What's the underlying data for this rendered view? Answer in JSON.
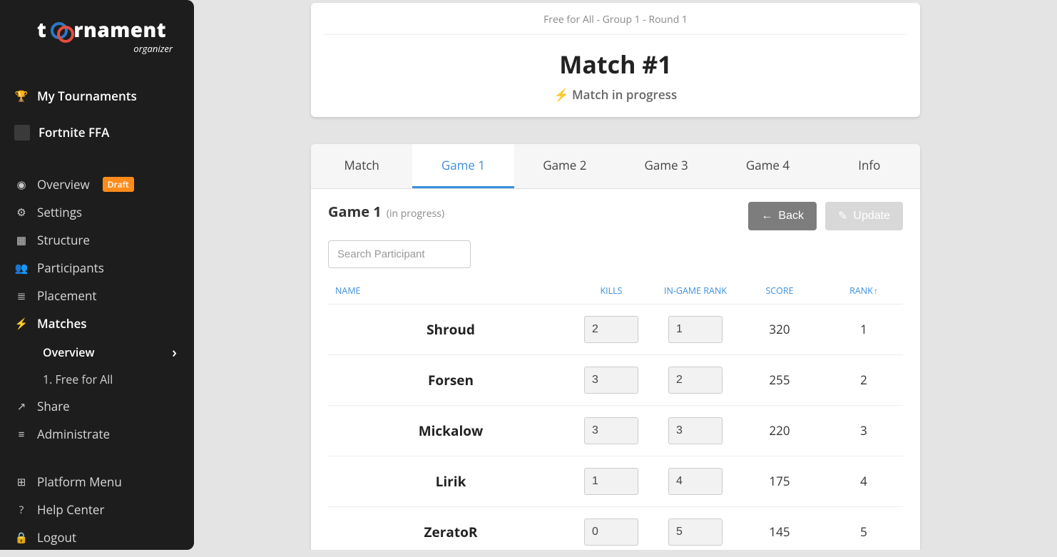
{
  "brand": {
    "name": "toornament",
    "subtitle": "organizer"
  },
  "sidebar": {
    "my_tournaments": "My Tournaments",
    "current_tournament": "Fortnite FFA",
    "items": [
      {
        "label": "Overview",
        "badge": "Draft"
      },
      {
        "label": "Settings"
      },
      {
        "label": "Structure"
      },
      {
        "label": "Participants"
      },
      {
        "label": "Placement"
      },
      {
        "label": "Matches"
      }
    ],
    "matches_sub": {
      "overview": "Overview",
      "stage": "1. Free for All"
    },
    "extra": [
      {
        "label": "Share"
      },
      {
        "label": "Administrate"
      }
    ],
    "bottom": [
      {
        "label": "Platform Menu"
      },
      {
        "label": "Help Center"
      },
      {
        "label": "Logout"
      }
    ]
  },
  "header": {
    "breadcrumb": "Free for All - Group 1 - Round 1",
    "title": "Match #1",
    "status": "Match in progress"
  },
  "tabs": [
    "Match",
    "Game 1",
    "Game 2",
    "Game 3",
    "Game 4",
    "Info"
  ],
  "active_tab_index": 1,
  "toolbar": {
    "game_label": "Game 1",
    "in_progress": "(in progress)",
    "back": "Back",
    "update": "Update",
    "search_placeholder": "Search Participant"
  },
  "columns": {
    "name": "NAME",
    "kills": "KILLS",
    "ingame_rank": "IN-GAME RANK",
    "score": "SCORE",
    "rank": "RANK"
  },
  "rows": [
    {
      "name": "Shroud",
      "kills": "2",
      "ingame_rank": "1",
      "score": "320",
      "rank": "1"
    },
    {
      "name": "Forsen",
      "kills": "3",
      "ingame_rank": "2",
      "score": "255",
      "rank": "2"
    },
    {
      "name": "Mickalow",
      "kills": "3",
      "ingame_rank": "3",
      "score": "220",
      "rank": "3"
    },
    {
      "name": "Lirik",
      "kills": "1",
      "ingame_rank": "4",
      "score": "175",
      "rank": "4"
    },
    {
      "name": "ZeratoR",
      "kills": "0",
      "ingame_rank": "5",
      "score": "145",
      "rank": "5"
    }
  ]
}
